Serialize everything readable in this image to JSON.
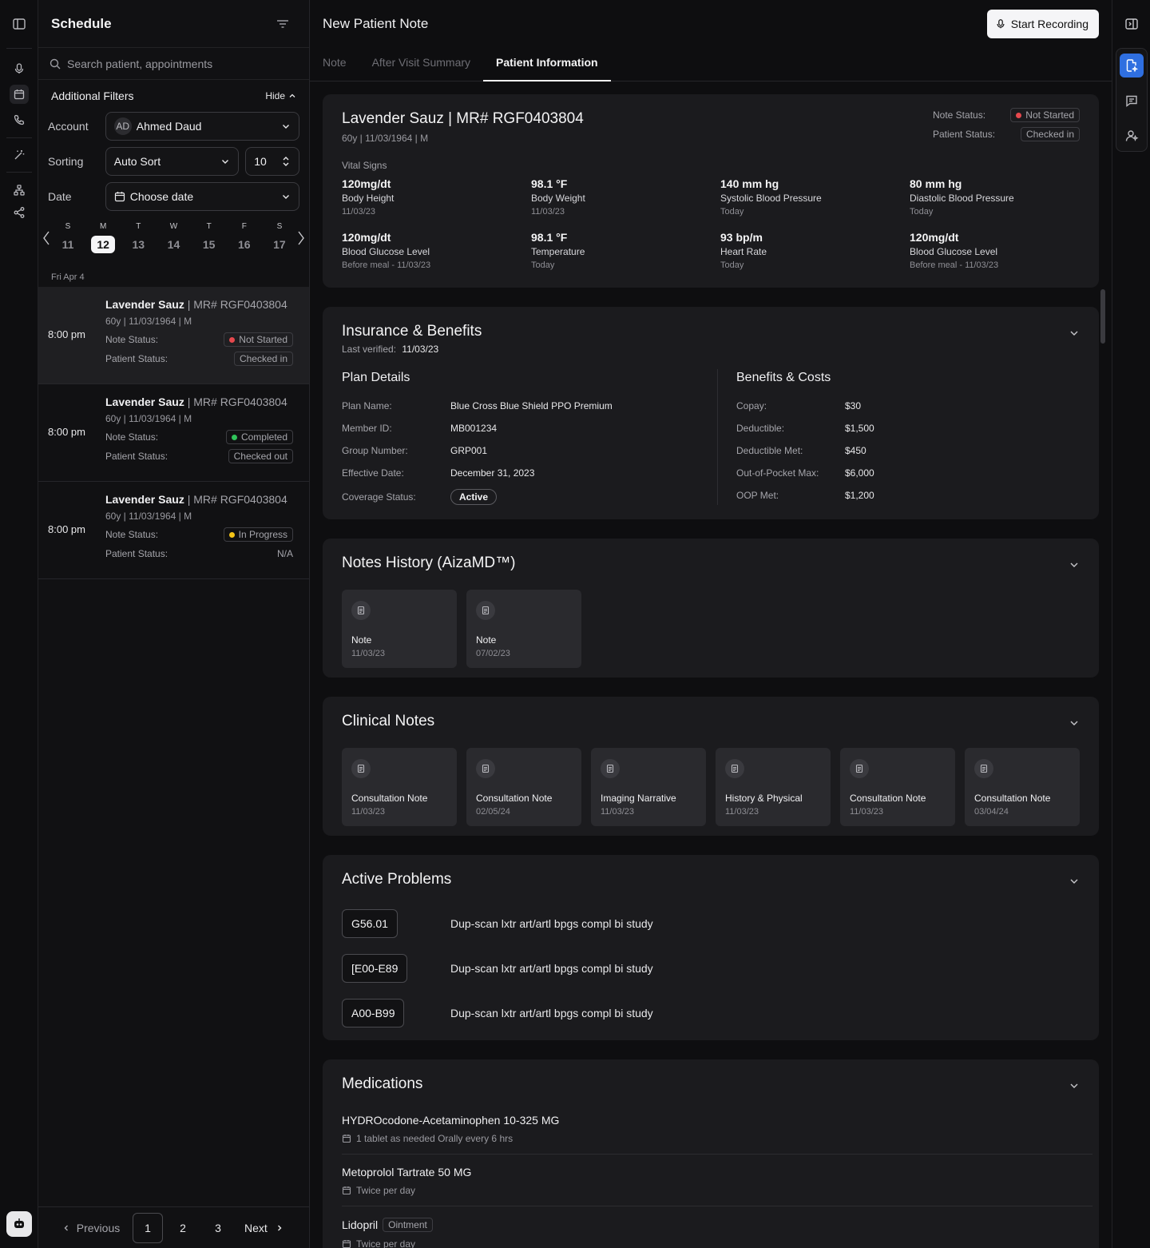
{
  "schedule": {
    "title": "Schedule",
    "search_placeholder": "Search patient, appointments",
    "filters_title": "Additional Filters",
    "hide_label": "Hide",
    "account_label": "Account",
    "account_initials": "AD",
    "account_name": "Ahmed Daud",
    "sorting_label": "Sorting",
    "sorting_value": "Auto Sort",
    "count_value": "10",
    "date_label": "Date",
    "date_placeholder": "Choose date",
    "calendar": [
      {
        "dow": "S",
        "day": "11"
      },
      {
        "dow": "M",
        "day": "12"
      },
      {
        "dow": "T",
        "day": "13"
      },
      {
        "dow": "W",
        "day": "14"
      },
      {
        "dow": "T",
        "day": "15"
      },
      {
        "dow": "F",
        "day": "16"
      },
      {
        "dow": "S",
        "day": "17"
      }
    ],
    "date_group": "Fri Apr 4",
    "appointments": [
      {
        "time": "8:00 pm",
        "name": "Lavender Sauz",
        "mr": " | MR# RGF0403804",
        "sub": "60y | 11/03/1964 | M",
        "note_label": "Note Status:",
        "note_status": "Not Started",
        "note_color": "#e5484d",
        "patient_label": "Patient Status:",
        "patient_status": "Checked in"
      },
      {
        "time": "8:00 pm",
        "name": "Lavender Sauz",
        "mr": " | MR# RGF0403804",
        "sub": "60y | 11/03/1964 | M",
        "note_label": "Note Status:",
        "note_status": "Completed",
        "note_color": "#30c35a",
        "patient_label": "Patient Status:",
        "patient_status": "Checked out"
      },
      {
        "time": "8:00 pm",
        "name": "Lavender Sauz",
        "mr": " | MR# RGF0403804",
        "sub": "60y | 11/03/1964 | M",
        "note_label": "Note Status:",
        "note_status": "In Progress",
        "note_color": "#f5c518",
        "patient_label": "Patient Status:",
        "patient_status": "N/A"
      }
    ],
    "pager": {
      "previous": "Previous",
      "pages": [
        "1",
        "2",
        "3"
      ],
      "next": "Next"
    }
  },
  "main": {
    "title": "New Patient Note",
    "record_label": "Start Recording",
    "tabs": [
      "Note",
      "After Visit Summary",
      "Patient Information"
    ],
    "patient": {
      "name": "Lavender Sauz | MR# RGF0403804",
      "sub": "60y | 11/03/1964 | M",
      "note_label": "Note Status:",
      "note_status": "Not Started",
      "patient_label": "Patient Status:",
      "patient_status": "Checked in",
      "vitals_title": "Vital Signs",
      "vitals": [
        {
          "value": "120mg/dt",
          "label": "Body Height",
          "date": "11/03/23"
        },
        {
          "value": "98.1 °F",
          "label": "Body Weight",
          "date": "11/03/23"
        },
        {
          "value": "140 mm hg",
          "label": "Systolic Blood Pressure",
          "date": "Today"
        },
        {
          "value": "80 mm hg",
          "label": "Diastolic Blood Pressure",
          "date": "Today"
        },
        {
          "value": "120mg/dt",
          "label": "Blood Glucose Level",
          "date": "Before meal - 11/03/23"
        },
        {
          "value": "98.1 °F",
          "label": "Temperature",
          "date": "Today"
        },
        {
          "value": "93 bp/m",
          "label": "Heart Rate",
          "date": "Today"
        },
        {
          "value": "120mg/dt",
          "label": "Blood Glucose Level",
          "date": "Before meal - 11/03/23"
        }
      ]
    },
    "insurance": {
      "title": "Insurance & Benefits",
      "verified_label": "Last verified:",
      "verified_date": "11/03/23",
      "plan_title": "Plan Details",
      "plan": [
        {
          "k": "Plan Name:",
          "v": "Blue Cross Blue Shield PPO Premium"
        },
        {
          "k": "Member ID:",
          "v": "MB001234"
        },
        {
          "k": "Group Number:",
          "v": "GRP001"
        },
        {
          "k": "Effective Date:",
          "v": "December 31, 2023"
        }
      ],
      "coverage_label": "Coverage Status:",
      "coverage_value": "Active",
      "benefits_title": "Benefits & Costs",
      "benefits": [
        {
          "k": "Copay:",
          "v": "$30"
        },
        {
          "k": "Deductible:",
          "v": "$1,500"
        },
        {
          "k": "Deductible Met:",
          "v": "$450"
        },
        {
          "k": "Out-of-Pocket Max:",
          "v": "$6,000"
        },
        {
          "k": "OOP Met:",
          "v": "$1,200"
        }
      ]
    },
    "notes_history": {
      "title": "Notes History (AizaMD™)",
      "items": [
        {
          "title": "Note",
          "date": "11/03/23"
        },
        {
          "title": "Note",
          "date": "07/02/23"
        }
      ]
    },
    "clinical_notes": {
      "title": "Clinical Notes",
      "items": [
        {
          "title": "Consultation Note",
          "date": "11/03/23"
        },
        {
          "title": "Consultation Note",
          "date": "02/05/24"
        },
        {
          "title": "Imaging Narrative",
          "date": "11/03/23"
        },
        {
          "title": "History & Physical",
          "date": "11/03/23"
        },
        {
          "title": "Consultation Note",
          "date": "11/03/23"
        },
        {
          "title": "Consultation Note",
          "date": "03/04/24"
        }
      ]
    },
    "active_problems": {
      "title": "Active Problems",
      "items": [
        {
          "code": "G56.01",
          "desc": "Dup-scan lxtr art/artl bpgs compl bi study"
        },
        {
          "code": "[E00-E89",
          "desc": "Dup-scan lxtr art/artl bpgs compl bi study"
        },
        {
          "code": "A00-B99",
          "desc": "Dup-scan lxtr art/artl bpgs compl bi study"
        }
      ]
    },
    "medications": {
      "title": "Medications",
      "items": [
        {
          "name": "HYDROcodone-Acetaminophen 10-325 MG",
          "tag": "",
          "dosage": "1 tablet as needed Orally every 6 hrs"
        },
        {
          "name": "Metoprolol Tartrate 50 MG",
          "tag": "",
          "dosage": "Twice per day"
        },
        {
          "name": "Lidopril",
          "tag": "Ointment",
          "dosage": "Twice per day"
        }
      ]
    }
  },
  "colors": {
    "accent": "#2f6fe0",
    "not_started": "#e5484d",
    "completed": "#30c35a",
    "in_progress": "#f5c518"
  }
}
